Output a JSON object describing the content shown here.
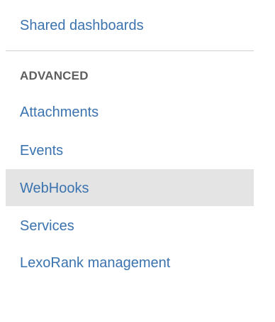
{
  "nav": {
    "top_items": [
      {
        "label": "Shared dashboards"
      }
    ],
    "advanced_section": {
      "heading": "ADVANCED",
      "items": [
        {
          "label": "Attachments",
          "selected": false
        },
        {
          "label": "Events",
          "selected": false
        },
        {
          "label": "WebHooks",
          "selected": true
        },
        {
          "label": "Services",
          "selected": false
        },
        {
          "label": "LexoRank management",
          "selected": false
        }
      ]
    }
  },
  "colors": {
    "link": "#3b73af",
    "heading": "#5e5e5e",
    "selected_background": "#e4e4e4",
    "divider": "#cfcfcf"
  }
}
